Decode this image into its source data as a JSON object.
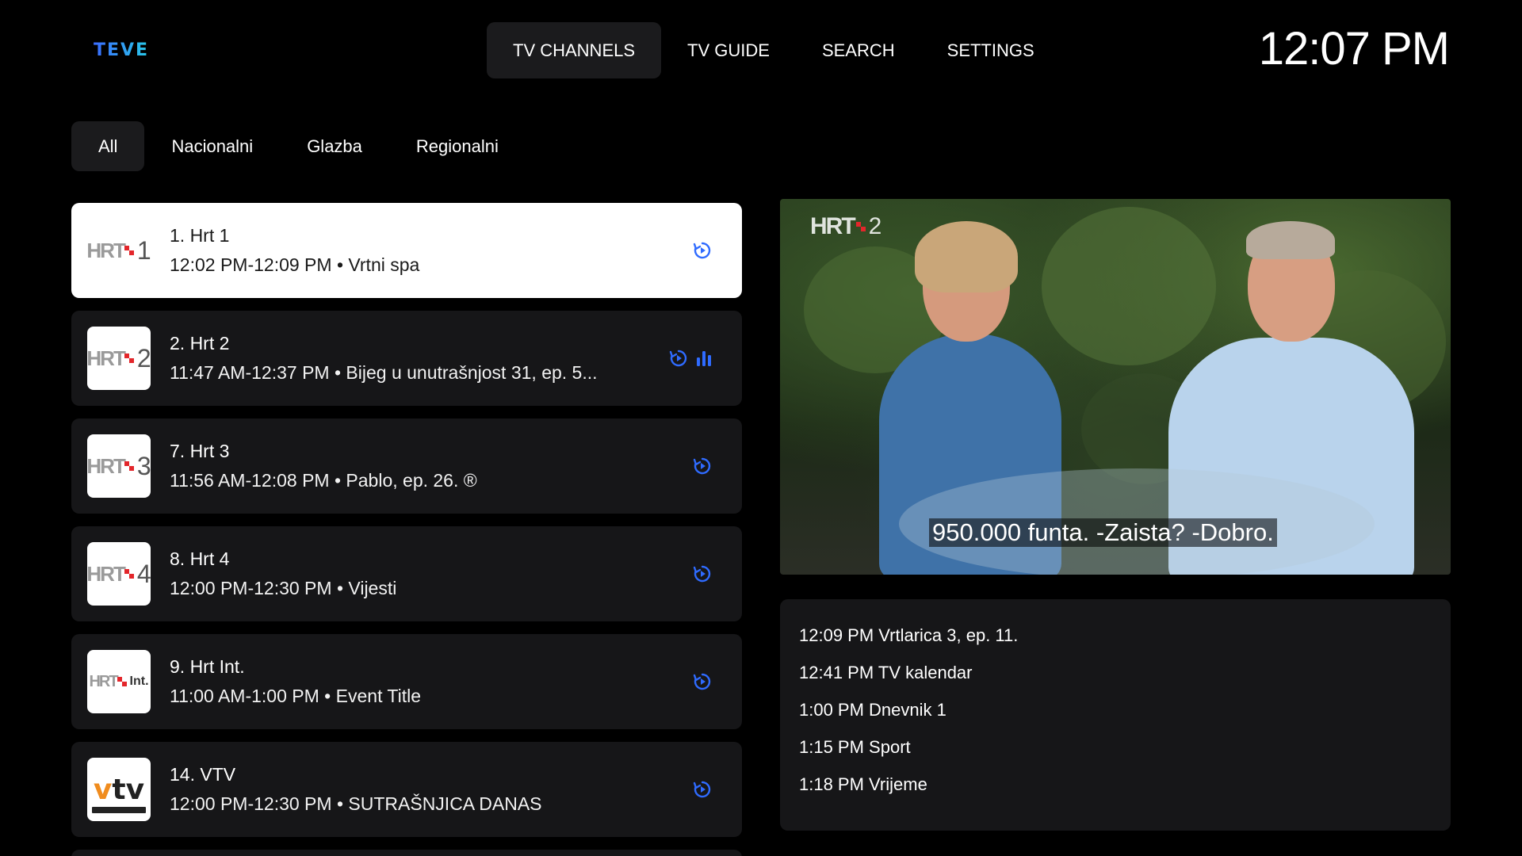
{
  "app": {
    "logo": "TEVE",
    "clock": "12:07 PM"
  },
  "nav": [
    {
      "label": "TV CHANNELS",
      "active": true
    },
    {
      "label": "TV GUIDE",
      "active": false
    },
    {
      "label": "SEARCH",
      "active": false
    },
    {
      "label": "SETTINGS",
      "active": false
    }
  ],
  "categories": [
    {
      "label": "All",
      "active": true
    },
    {
      "label": "Nacionalni",
      "active": false
    },
    {
      "label": "Glazba",
      "active": false
    },
    {
      "label": "Regionalni",
      "active": false
    }
  ],
  "channels": [
    {
      "title": "1. Hrt 1",
      "time": "12:02 PM-12:09 PM",
      "program": "Vrtni spa",
      "logo_text": "HRT",
      "logo_num": "1",
      "icons": [
        "replay-icon"
      ],
      "selected": true
    },
    {
      "title": "2. Hrt 2",
      "time": "11:47 AM-12:37 PM",
      "program": "Bijeg u unutrašnjost 31, ep. 5...",
      "logo_text": "HRT",
      "logo_num": "2",
      "icons": [
        "replay-icon",
        "now-playing-icon"
      ],
      "selected": false
    },
    {
      "title": "7. Hrt 3",
      "time": "11:56 AM-12:08 PM",
      "program": "Pablo, ep. 26. ®",
      "logo_text": "HRT",
      "logo_num": "3",
      "icons": [
        "replay-icon"
      ],
      "selected": false
    },
    {
      "title": "8. Hrt 4",
      "time": "12:00 PM-12:30 PM",
      "program": "Vijesti",
      "logo_text": "HRT",
      "logo_num": "4",
      "icons": [
        "replay-icon"
      ],
      "selected": false
    },
    {
      "title": "9. Hrt Int.",
      "time": "11:00 AM-1:00 PM",
      "program": "Event Title",
      "logo_text": "HRT",
      "logo_num": "Int.",
      "icons": [
        "replay-icon"
      ],
      "selected": false
    },
    {
      "title": "14. VTV",
      "time": "12:00 PM-12:30 PM",
      "program": "SUTRAŠNJICA DANAS",
      "logo_text": "vtv",
      "logo_num": "",
      "icons": [
        "replay-icon"
      ],
      "selected": false
    }
  ],
  "preview": {
    "channel_logo_text": "HRT",
    "channel_logo_num": "2",
    "subtitle": "950.000 funta. -Zaista? -Dobro."
  },
  "schedule": [
    "12:09 PM Vrtlarica 3, ep. 11.",
    "12:41 PM TV kalendar",
    "1:00 PM Dnevnik 1",
    "1:15 PM Sport",
    "1:18 PM Vrijeme"
  ],
  "colors": {
    "accent": "#2f6bff",
    "card": "#161618",
    "selected_card": "#ffffff",
    "background": "#000000"
  }
}
